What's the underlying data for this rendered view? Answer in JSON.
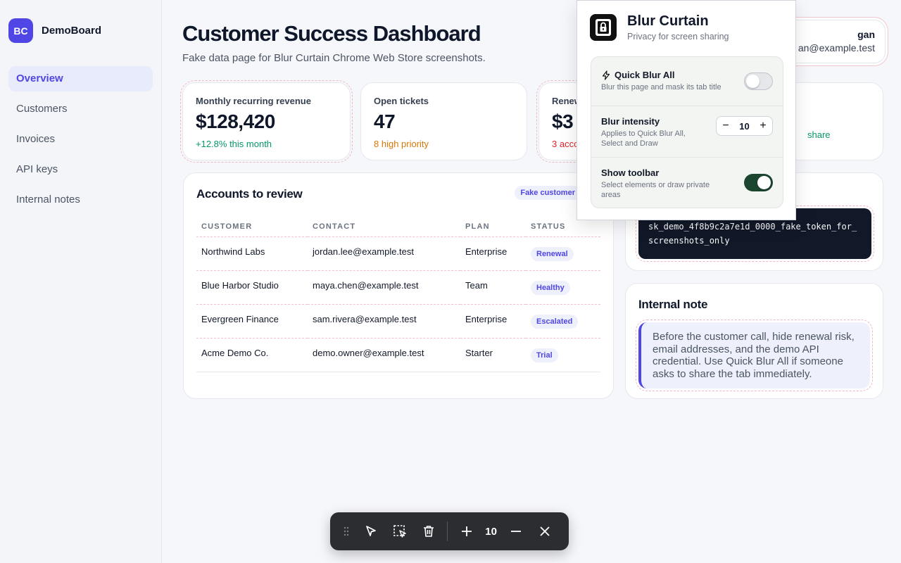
{
  "sidebar": {
    "logo_initials": "BC",
    "brand": "DemoBoard",
    "items": [
      {
        "label": "Overview"
      },
      {
        "label": "Customers"
      },
      {
        "label": "Invoices"
      },
      {
        "label": "API keys"
      },
      {
        "label": "Internal notes"
      }
    ]
  },
  "header": {
    "title": "Customer Success Dashboard",
    "subtitle": "Fake data page for Blur Curtain Chrome Web Store screenshots."
  },
  "user": {
    "name": "gan",
    "email": "an@example.test"
  },
  "metrics": [
    {
      "label": "Monthly recurring revenue",
      "value": "$128,420",
      "note": "+12.8% this month",
      "note_color": "#059669"
    },
    {
      "label": "Open tickets",
      "value": "47",
      "note": "8 high priority",
      "note_color": "#d97706"
    },
    {
      "label": "Renew",
      "value": "$3",
      "note": "3 acco",
      "note_color": "#dc2626"
    },
    {
      "label": "",
      "value": "",
      "note": "share",
      "note_color": "#059669"
    }
  ],
  "accounts": {
    "title": "Accounts to review",
    "badge": "Fake customer",
    "columns": [
      "CUSTOMER",
      "CONTACT",
      "PLAN",
      "STATUS"
    ],
    "rows": [
      {
        "customer": "Northwind Labs",
        "contact": "jordan.lee@example.test",
        "plan": "Enterprise",
        "status": "Renewal"
      },
      {
        "customer": "Blue Harbor Studio",
        "contact": "maya.chen@example.test",
        "plan": "Team",
        "status": "Healthy"
      },
      {
        "customer": "Evergreen Finance",
        "contact": "sam.rivera@example.test",
        "plan": "Enterprise",
        "status": "Escalated"
      },
      {
        "customer": "Acme Demo Co.",
        "contact": "demo.owner@example.test",
        "plan": "Starter",
        "status": "Trial"
      }
    ]
  },
  "api": {
    "token": "sk_demo_4f8b9c2a7e1d_0000_fake_token_for_screenshots_only"
  },
  "note": {
    "title": "Internal note",
    "body": "Before the customer call, hide renewal risk, email addresses, and the demo API credential. Use Quick Blur All if someone asks to share the tab immediately."
  },
  "popup": {
    "title": "Blur Curtain",
    "subtitle": "Privacy for screen sharing",
    "quick_blur": {
      "title": "Quick Blur All",
      "desc": "Blur this page and mask its tab title",
      "enabled": false
    },
    "intensity": {
      "title": "Blur intensity",
      "desc": "Applies to Quick Blur All, Select and Draw",
      "value": "10"
    },
    "toolbar": {
      "title": "Show toolbar",
      "desc": "Select elements or draw private areas",
      "enabled": true
    }
  },
  "floating_toolbar": {
    "value": "10"
  },
  "colors": {
    "accent": "#4f46e5",
    "toggle_on": "#1c4530",
    "toolbar_bg": "#2b2d31"
  }
}
